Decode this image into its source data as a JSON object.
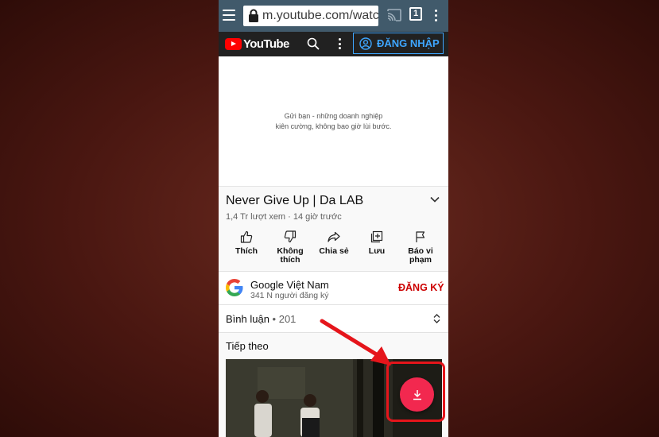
{
  "browser": {
    "url": "m.youtube.com/watch",
    "tab_count": "1"
  },
  "youtube": {
    "logo_text": "YouTube",
    "signin_label": "ĐĂNG NHẬP"
  },
  "video": {
    "caption_line1": "Gửi bạn - những doanh nghiệp",
    "caption_line2": "kiên cường, không bao giờ lùi bước.",
    "title": "Never Give Up | Da LAB",
    "meta": "1,4 Tr lượt xem · 14 giờ trước",
    "actions": [
      {
        "line1": "Thích",
        "line2": ""
      },
      {
        "line1": "Không",
        "line2": "thích"
      },
      {
        "line1": "Chia sẻ",
        "line2": ""
      },
      {
        "line1": "Lưu",
        "line2": ""
      },
      {
        "line1": "Báo vi",
        "line2": "phạm"
      }
    ]
  },
  "channel": {
    "name": "Google Việt Nam",
    "subscribers": "341 N người đăng ký",
    "subscribe_label": "ĐĂNG KÝ"
  },
  "comments": {
    "label": "Bình luận",
    "separator": " • ",
    "count": "201"
  },
  "up_next": {
    "label": "Tiếp theo"
  },
  "colors": {
    "browser_bar": "#415a6b",
    "youtube_red": "#ff0000",
    "signin_blue": "#3ea6ff",
    "subscribe_red": "#cc0000",
    "fab_pink": "#f2284f",
    "highlight_red": "#e5151b"
  },
  "icons": [
    "menu-icon",
    "lock-icon",
    "cast-icon",
    "tabs-icon",
    "more-vert-icon",
    "search-icon",
    "account-icon",
    "chevron-down-icon",
    "thumb-up-icon",
    "thumb-down-icon",
    "share-icon",
    "add-to-playlist-icon",
    "flag-icon",
    "google-logo-icon",
    "sort-icon",
    "download-icon",
    "arrow-annotation-icon"
  ]
}
